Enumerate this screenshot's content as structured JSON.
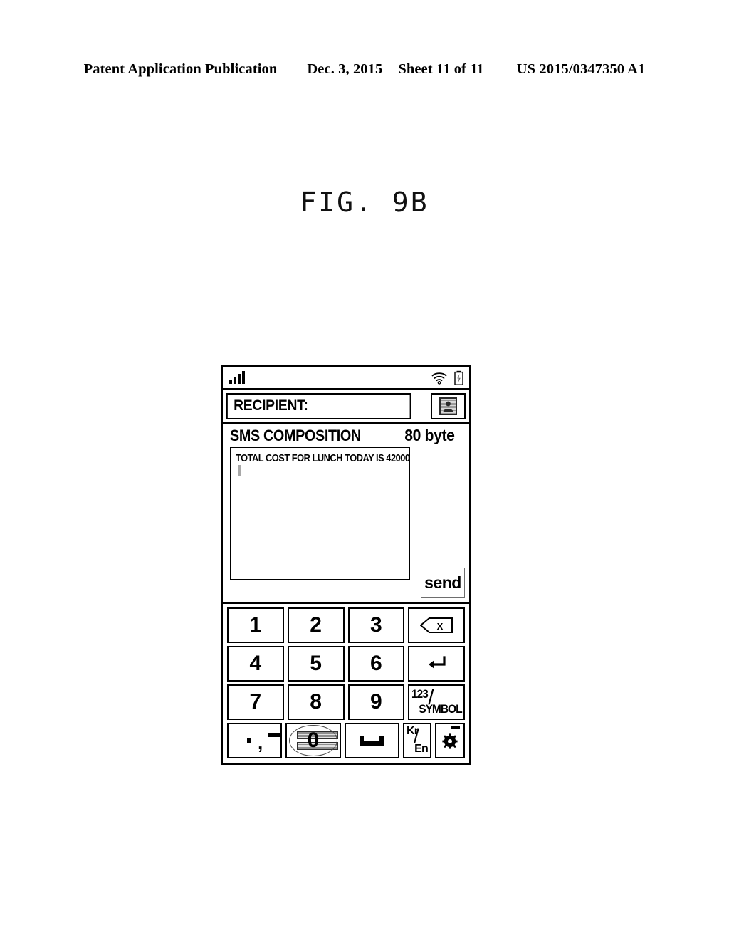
{
  "page_header": {
    "publication": "Patent Application Publication",
    "date": "Dec. 3, 2015",
    "sheet": "Sheet 11 of 11",
    "pub_number": "US 2015/0347350 A1"
  },
  "figure": {
    "label": "FIG. 9B"
  },
  "device": {
    "status_bar": {
      "signal_icon": "signal-bars-icon",
      "signal_bars": 4,
      "wifi_icon": "wifi-icon",
      "battery_icon": "battery-charging-icon"
    },
    "recipient": {
      "label": "RECIPIENT:",
      "value": "",
      "contact_button_icon": "contact-person-icon"
    },
    "composition": {
      "title": "SMS COMPOSITION",
      "byte_count": "80 byte",
      "message_text": "TOTAL COST FOR LUNCH TODAY IS 42000",
      "caret_visible": true,
      "send_label": "send"
    },
    "keypad": {
      "row1": [
        {
          "name": "key-1",
          "label": "1"
        },
        {
          "name": "key-2",
          "label": "2"
        },
        {
          "name": "key-3",
          "label": "3"
        },
        {
          "name": "key-backspace",
          "label": "X",
          "icon": "backspace-icon"
        }
      ],
      "row2": [
        {
          "name": "key-4",
          "label": "4"
        },
        {
          "name": "key-5",
          "label": "5"
        },
        {
          "name": "key-6",
          "label": "6"
        },
        {
          "name": "key-enter",
          "label": "↵",
          "icon": "enter-return-icon"
        }
      ],
      "row3": [
        {
          "name": "key-7",
          "label": "7"
        },
        {
          "name": "key-8",
          "label": "8"
        },
        {
          "name": "key-9",
          "label": "9"
        },
        {
          "name": "key-symbol",
          "label_top": "123",
          "label_slash": "/",
          "label_bottom": "SYMBOL"
        }
      ],
      "row4": [
        {
          "name": "key-punctuation",
          "label": ". , –"
        },
        {
          "name": "key-0",
          "label": "0",
          "gesture": "vertical-swipe-highlight"
        },
        {
          "name": "key-space",
          "icon": "space-bar-icon"
        },
        {
          "name": "key-language-toggle",
          "label_top": "Kr",
          "label_slash": "/",
          "label_bottom": "En"
        },
        {
          "name": "key-settings",
          "icon": "gear-icon"
        }
      ]
    }
  },
  "colors": {
    "ink": "#000000",
    "paper": "#ffffff",
    "caret": "#a8a8a8",
    "hatch": "#9a9a9a"
  }
}
